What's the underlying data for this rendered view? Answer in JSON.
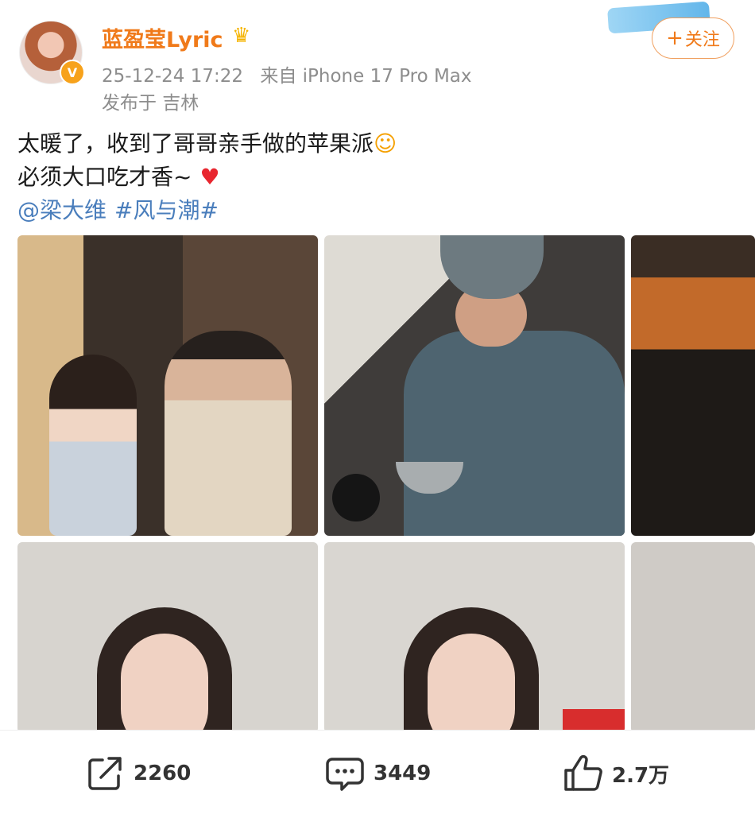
{
  "post": {
    "author": {
      "name": "蓝盈莹Lyric",
      "verified": true,
      "badge_icon": "crown-icon",
      "verified_icon": "verified-v-icon"
    },
    "timestamp": "25-12-24 17:22",
    "source": "来自 iPhone 17 Pro Max",
    "location": "发布于 吉林",
    "follow_label": "关注",
    "text_line1": "太暖了，收到了哥哥亲手做的苹果派",
    "text_line2": "必须大口吃才香~",
    "mention": "@梁大维",
    "hashtag": "#风与潮#",
    "emoji_line1": "smiling-face-emoji",
    "emoji_line2": "red-heart-emoji",
    "photos": [
      {
        "desc": "photo-1"
      },
      {
        "desc": "photo-2"
      },
      {
        "desc": "photo-3"
      },
      {
        "desc": "photo-4"
      },
      {
        "desc": "photo-5"
      },
      {
        "desc": "photo-6"
      }
    ]
  },
  "actions": {
    "share_count": "2260",
    "comment_count": "3449",
    "like_count": "2.7万"
  },
  "colors": {
    "username": "#f07a1a",
    "link": "#4a7ebc",
    "meta": "#8d8d8d",
    "heart": "#e8262f"
  }
}
